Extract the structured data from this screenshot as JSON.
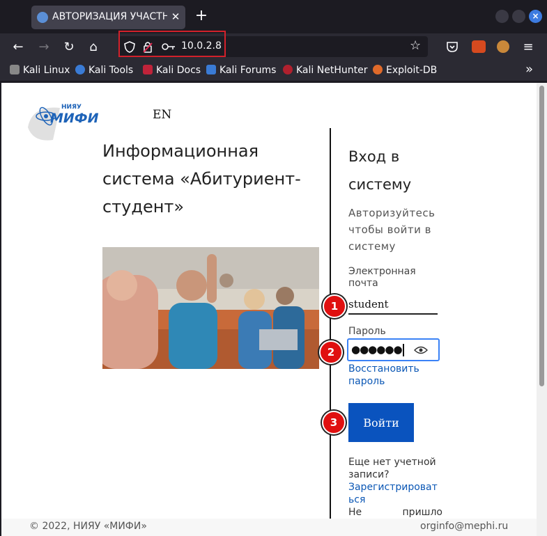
{
  "browser": {
    "tab_title": "АВТОРИЗАЦИЯ УЧАСТНИ",
    "tab_close": "✕",
    "new_tab": "+",
    "url": "10.0.2.8",
    "win_close": "×",
    "bookmarks": [
      "Kali Linux",
      "Kali Tools",
      "Kali Docs",
      "Kali Forums",
      "Kali NetHunter",
      "Exploit-DB"
    ],
    "bookmarks_overflow": "»"
  },
  "page": {
    "logo_text_top": "НИЯУ",
    "logo_text_main": "МИФИ",
    "lang_switch": "EN",
    "title": "Информационная система «Абитуриент-студент»",
    "login": {
      "title": "Вход в систему",
      "subtitle": "Авторизуйтесь чтобы войти в систему",
      "email_label": "Электронная почта",
      "email_value": "student",
      "password_label": "Пароль",
      "password_masked": "●●●●●●",
      "restore_link": "Восстановить пароль",
      "submit": "Войти",
      "no_account": "Еще нет учетной записи?",
      "register_link": "Зарегистрироваться",
      "not_received": "Не пришло"
    },
    "markers": [
      "1",
      "2",
      "3"
    ],
    "footer_left": "© 2022, НИЯУ «МИФИ»",
    "footer_right": "orginfo@mephi.ru"
  },
  "colors": {
    "accent": "#0a53be",
    "marker": "#e01010",
    "highlight": "#d3212b"
  }
}
